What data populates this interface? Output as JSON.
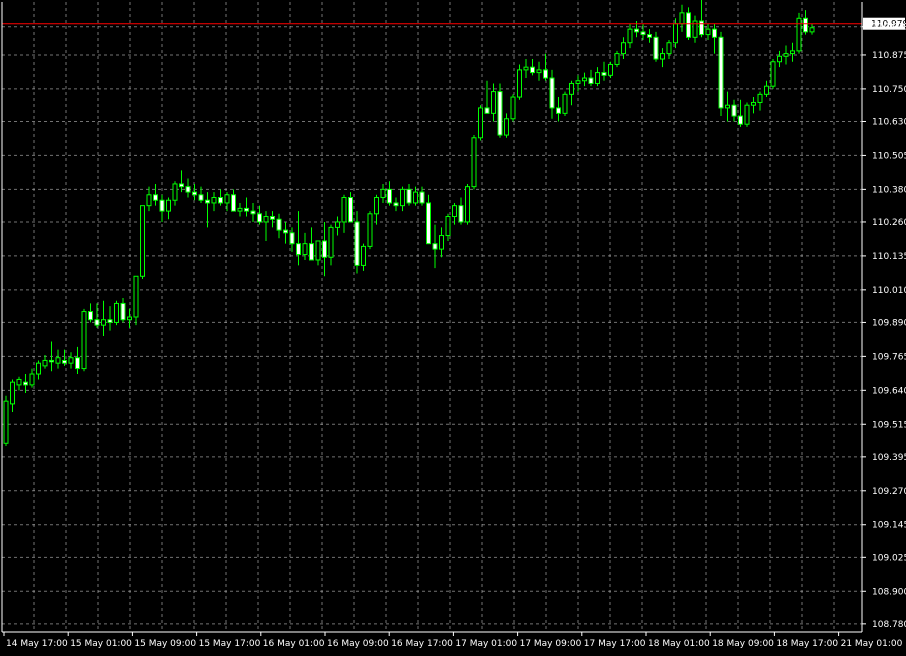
{
  "window": {
    "symbol": "USDJPY",
    "timeframe": "H1"
  },
  "colors": {
    "background": "#000000",
    "grid": "#c0c0c0",
    "axis": "#ffffff",
    "text": "#ffffff",
    "bull_body": "#000000",
    "bull_outline": "#00ff00",
    "bear_body": "#ffffff",
    "bear_outline": "#00ff00",
    "wick": "#00ff00",
    "current_price_line": "#ff0000",
    "current_price_badge": "#ffffff"
  },
  "chart_data": {
    "type": "candlestick",
    "title": "",
    "xlabel": "",
    "ylabel": "",
    "grid": true,
    "ylim": [
      108.75,
      111.07
    ],
    "y_ticks": [
      "110.979",
      "110.875",
      "110.750",
      "110.630",
      "110.505",
      "110.380",
      "110.260",
      "110.135",
      "110.010",
      "109.890",
      "109.765",
      "109.640",
      "109.515",
      "109.395",
      "109.270",
      "109.145",
      "109.025",
      "108.900",
      "108.780"
    ],
    "x_ticks": [
      "14 May 17:00",
      "15 May 01:00",
      "15 May 09:00",
      "15 May 17:00",
      "16 May 01:00",
      "16 May 09:00",
      "16 May 17:00",
      "17 May 01:00",
      "17 May 09:00",
      "17 May 17:00",
      "18 May 01:00",
      "18 May 09:00",
      "18 May 17:00",
      "21 May 01:00"
    ],
    "current_price": 110.979,
    "candles": [
      [
        109.445,
        109.62,
        109.435,
        109.6
      ],
      [
        109.59,
        109.68,
        109.56,
        109.67
      ],
      [
        109.66,
        109.69,
        109.64,
        109.68
      ],
      [
        109.67,
        109.7,
        109.63,
        109.66
      ],
      [
        109.66,
        109.72,
        109.65,
        109.7
      ],
      [
        109.7,
        109.75,
        109.68,
        109.74
      ],
      [
        109.73,
        109.77,
        109.72,
        109.75
      ],
      [
        109.75,
        109.82,
        109.71,
        109.745
      ],
      [
        109.74,
        109.79,
        109.72,
        109.76
      ],
      [
        109.75,
        109.79,
        109.73,
        109.74
      ],
      [
        109.74,
        109.78,
        109.72,
        109.76
      ],
      [
        109.76,
        109.8,
        109.7,
        109.72
      ],
      [
        109.72,
        109.94,
        109.71,
        109.93
      ],
      [
        109.93,
        109.96,
        109.89,
        109.9
      ],
      [
        109.9,
        109.96,
        109.87,
        109.88
      ],
      [
        109.88,
        109.97,
        109.84,
        109.9
      ],
      [
        109.9,
        109.95,
        109.86,
        109.89
      ],
      [
        109.89,
        109.97,
        109.88,
        109.96
      ],
      [
        109.96,
        109.98,
        109.89,
        109.9
      ],
      [
        109.9,
        109.94,
        109.87,
        109.91
      ],
      [
        109.91,
        110.06,
        109.88,
        110.06
      ],
      [
        110.06,
        110.32,
        110.05,
        110.32
      ],
      [
        110.32,
        110.39,
        110.3,
        110.36
      ],
      [
        110.36,
        110.4,
        110.32,
        110.34
      ],
      [
        110.34,
        110.36,
        110.26,
        110.3
      ],
      [
        110.3,
        110.35,
        110.27,
        110.34
      ],
      [
        110.34,
        110.41,
        110.32,
        110.4
      ],
      [
        110.4,
        110.45,
        110.37,
        110.39
      ],
      [
        110.39,
        110.42,
        110.35,
        110.37
      ],
      [
        110.37,
        110.4,
        110.34,
        110.36
      ],
      [
        110.36,
        110.39,
        110.33,
        110.34
      ],
      [
        110.34,
        110.37,
        110.24,
        110.33
      ],
      [
        110.33,
        110.37,
        110.3,
        110.35
      ],
      [
        110.35,
        110.38,
        110.32,
        110.33
      ],
      [
        110.33,
        110.37,
        110.3,
        110.36
      ],
      [
        110.36,
        110.38,
        110.3,
        110.3
      ],
      [
        110.3,
        110.33,
        110.28,
        110.31
      ],
      [
        110.31,
        110.35,
        110.28,
        110.3
      ],
      [
        110.3,
        110.33,
        110.26,
        110.29
      ],
      [
        110.29,
        110.32,
        110.25,
        110.26
      ],
      [
        110.26,
        110.3,
        110.19,
        110.28
      ],
      [
        110.28,
        110.3,
        110.24,
        110.27
      ],
      [
        110.27,
        110.29,
        110.2,
        110.23
      ],
      [
        110.23,
        110.26,
        110.18,
        110.22
      ],
      [
        110.22,
        110.24,
        110.15,
        110.18
      ],
      [
        110.18,
        110.3,
        110.1,
        110.14
      ],
      [
        110.14,
        110.22,
        110.12,
        110.18
      ],
      [
        110.18,
        110.24,
        110.13,
        110.12
      ],
      [
        110.12,
        110.18,
        110.1,
        110.19
      ],
      [
        110.19,
        110.26,
        110.06,
        110.13
      ],
      [
        110.13,
        110.25,
        110.1,
        110.24
      ],
      [
        110.24,
        110.28,
        110.21,
        110.26
      ],
      [
        110.26,
        110.36,
        110.22,
        110.35
      ],
      [
        110.35,
        110.37,
        110.27,
        110.26
      ],
      [
        110.26,
        110.3,
        110.07,
        110.1
      ],
      [
        110.1,
        110.18,
        110.08,
        110.17
      ],
      [
        110.17,
        110.3,
        110.16,
        110.29
      ],
      [
        110.29,
        110.36,
        110.25,
        110.35
      ],
      [
        110.35,
        110.4,
        110.33,
        110.38
      ],
      [
        110.38,
        110.41,
        110.32,
        110.33
      ],
      [
        110.33,
        110.35,
        110.3,
        110.32
      ],
      [
        110.32,
        110.39,
        110.3,
        110.38
      ],
      [
        110.38,
        110.4,
        110.32,
        110.33
      ],
      [
        110.33,
        110.39,
        110.32,
        110.37
      ],
      [
        110.37,
        110.39,
        110.32,
        110.33
      ],
      [
        110.33,
        110.36,
        110.18,
        110.18
      ],
      [
        110.18,
        110.25,
        110.09,
        110.16
      ],
      [
        110.16,
        110.24,
        110.13,
        110.21
      ],
      [
        110.21,
        110.29,
        110.19,
        110.28
      ],
      [
        110.28,
        110.33,
        110.25,
        110.32
      ],
      [
        110.32,
        110.35,
        110.25,
        110.26
      ],
      [
        110.26,
        110.4,
        110.25,
        110.39
      ],
      [
        110.39,
        110.58,
        110.38,
        110.57
      ],
      [
        110.57,
        110.69,
        110.56,
        110.68
      ],
      [
        110.68,
        110.78,
        110.66,
        110.66
      ],
      [
        110.66,
        110.77,
        110.63,
        110.74
      ],
      [
        110.74,
        110.77,
        110.57,
        110.58
      ],
      [
        110.58,
        110.66,
        110.57,
        110.64
      ],
      [
        110.64,
        110.73,
        110.63,
        110.72
      ],
      [
        110.72,
        110.84,
        110.71,
        110.82
      ],
      [
        110.82,
        110.86,
        110.79,
        110.83
      ],
      [
        110.83,
        110.86,
        110.8,
        110.81
      ],
      [
        110.81,
        110.85,
        110.78,
        110.82
      ],
      [
        110.82,
        110.88,
        110.78,
        110.79
      ],
      [
        110.79,
        110.82,
        110.64,
        110.68
      ],
      [
        110.68,
        110.72,
        110.63,
        110.66
      ],
      [
        110.66,
        110.74,
        110.65,
        110.73
      ],
      [
        110.73,
        110.78,
        110.69,
        110.77
      ],
      [
        110.77,
        110.8,
        110.74,
        110.78
      ],
      [
        110.78,
        110.81,
        110.76,
        110.79
      ],
      [
        110.79,
        110.82,
        110.76,
        110.77
      ],
      [
        110.77,
        110.83,
        110.76,
        110.81
      ],
      [
        110.81,
        110.85,
        110.78,
        110.8
      ],
      [
        110.8,
        110.85,
        110.79,
        110.84
      ],
      [
        110.84,
        110.89,
        110.83,
        110.88
      ],
      [
        110.88,
        110.94,
        110.86,
        110.92
      ],
      [
        110.92,
        110.99,
        110.9,
        110.97
      ],
      [
        110.97,
        111.0,
        110.94,
        110.96
      ],
      [
        110.96,
        110.99,
        110.93,
        110.95
      ],
      [
        110.95,
        110.97,
        110.92,
        110.94
      ],
      [
        110.94,
        110.96,
        110.85,
        110.86
      ],
      [
        110.86,
        110.9,
        110.83,
        110.88
      ],
      [
        110.88,
        110.93,
        110.86,
        110.92
      ],
      [
        110.92,
        111.01,
        110.9,
        110.99
      ],
      [
        110.99,
        111.06,
        110.96,
        111.03
      ],
      [
        111.03,
        111.05,
        110.93,
        110.94
      ],
      [
        110.94,
        111.02,
        110.92,
        111.0
      ],
      [
        111.0,
        111.08,
        110.94,
        110.95
      ],
      [
        110.95,
        110.99,
        110.93,
        110.97
      ],
      [
        110.97,
        110.99,
        110.88,
        110.94
      ],
      [
        110.94,
        110.96,
        110.65,
        110.68
      ],
      [
        110.68,
        110.74,
        110.63,
        110.69
      ],
      [
        110.69,
        110.71,
        110.63,
        110.65
      ],
      [
        110.65,
        110.71,
        110.61,
        110.62
      ],
      [
        110.62,
        110.7,
        110.61,
        110.69
      ],
      [
        110.69,
        110.72,
        110.66,
        110.7
      ],
      [
        110.7,
        110.74,
        110.67,
        110.73
      ],
      [
        110.73,
        110.78,
        110.72,
        110.76
      ],
      [
        110.76,
        110.86,
        110.75,
        110.85
      ],
      [
        110.85,
        110.89,
        110.83,
        110.87
      ],
      [
        110.87,
        110.91,
        110.84,
        110.88
      ],
      [
        110.88,
        110.92,
        110.85,
        110.89
      ],
      [
        110.89,
        111.03,
        110.88,
        111.01
      ],
      [
        111.01,
        111.04,
        110.95,
        110.96
      ],
      [
        110.96,
        110.99,
        110.95,
        110.975
      ]
    ]
  }
}
